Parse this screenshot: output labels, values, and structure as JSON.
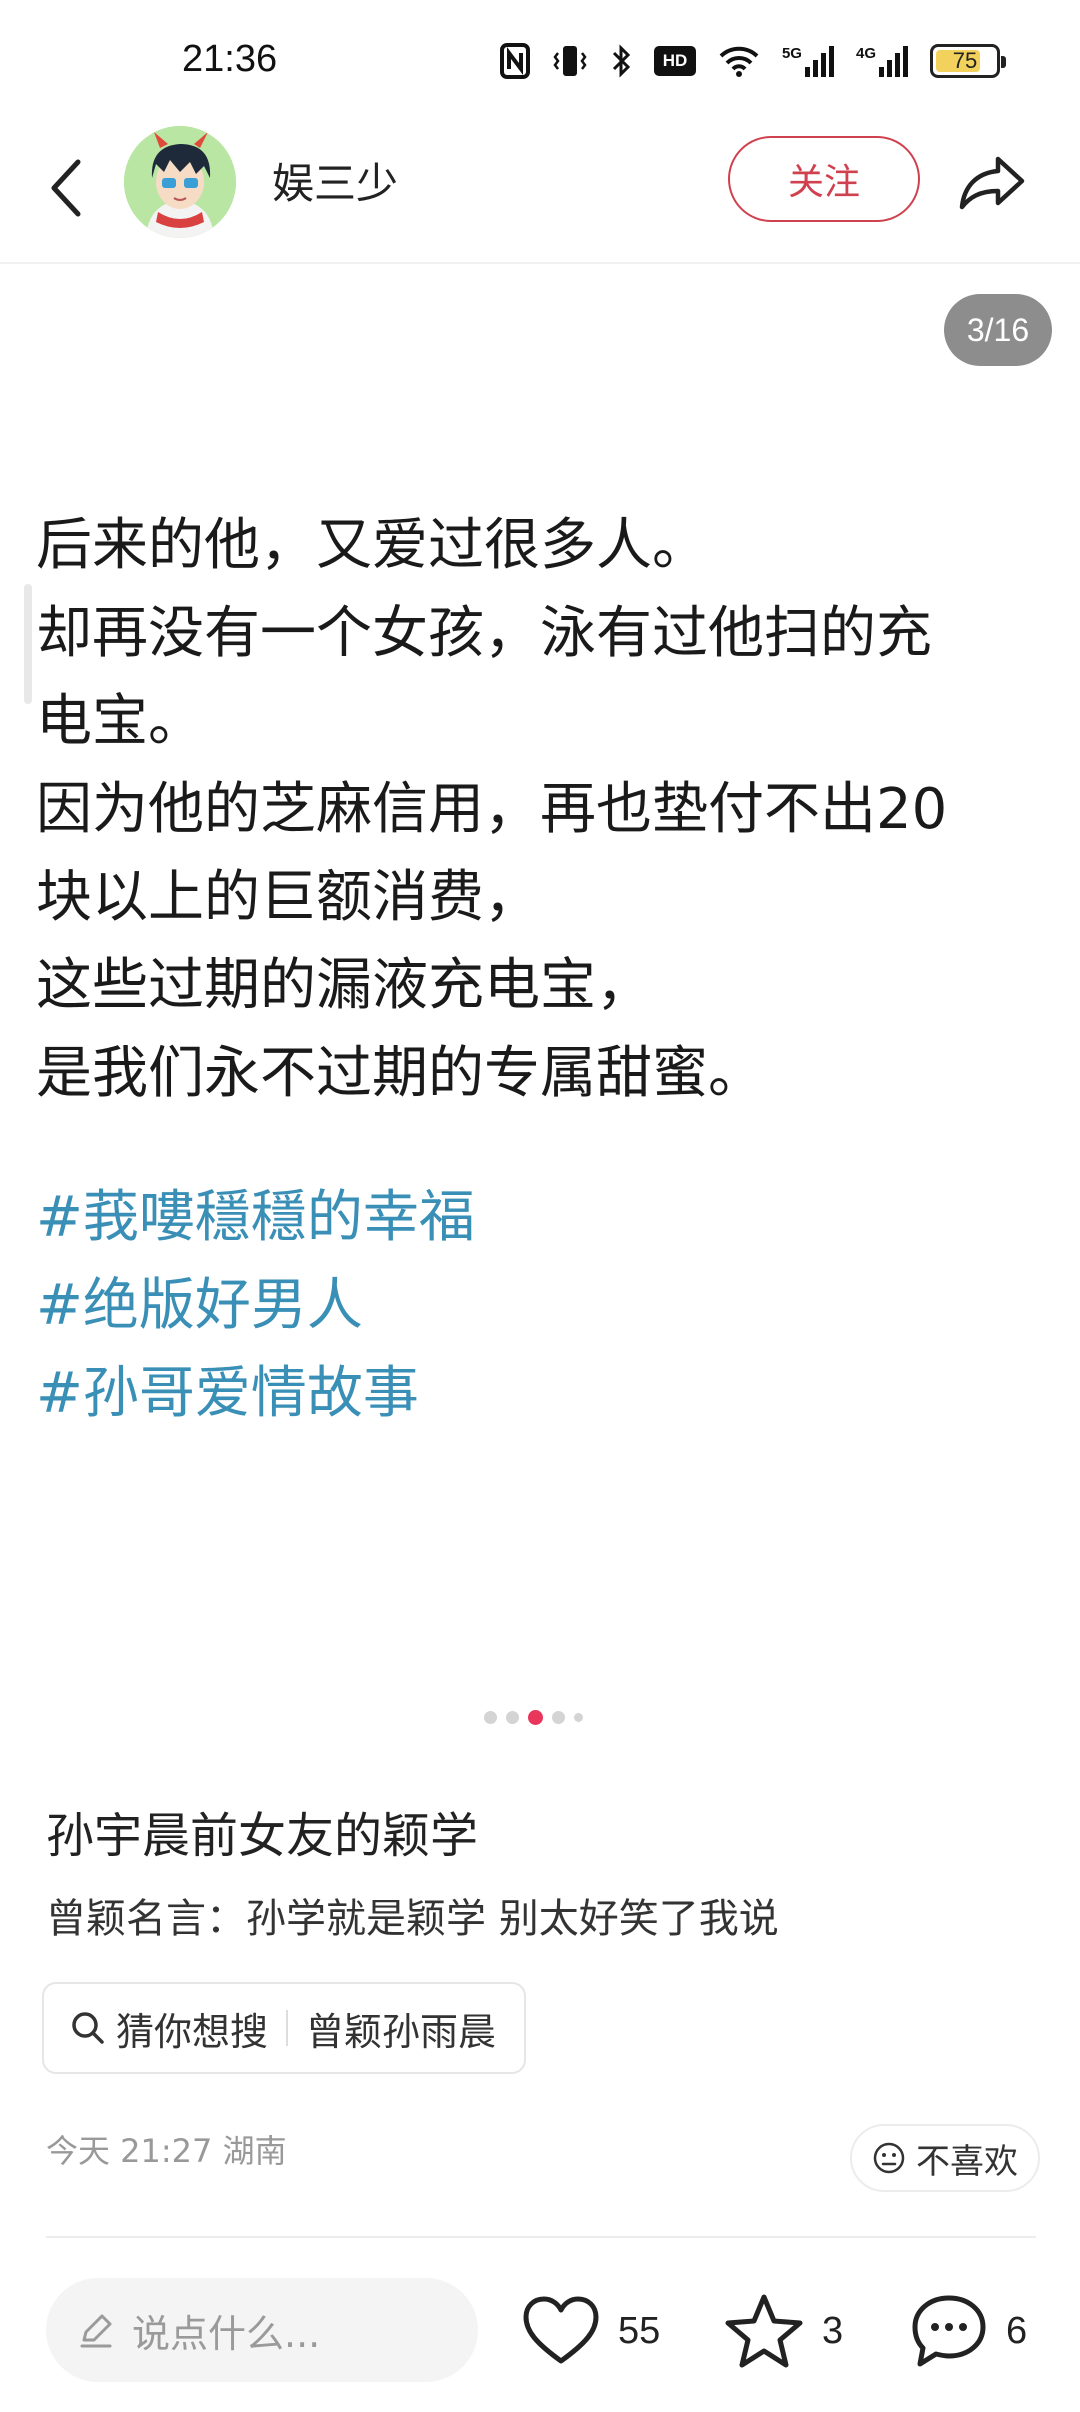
{
  "status_bar": {
    "time": "21:36",
    "icons": [
      "nfc-icon",
      "vibrate-icon",
      "bluetooth-icon",
      "hd-icon",
      "wifi-icon",
      "signal-5g-icon",
      "signal-4g-icon",
      "battery-icon"
    ],
    "hd_label": "HD",
    "network_5g": "5G",
    "network_4g": "4G",
    "battery_level": "75",
    "battery_fraction": 0.75
  },
  "header": {
    "username": "娱三少",
    "follow_label": "关注"
  },
  "content": {
    "page_counter": "3/16",
    "current_page_dot": 3,
    "body_lines": [
      "后来的他，又爱过很多人。",
      "却再没有一个女孩，泳有过他扫的充",
      "电宝。",
      "因为他的芝麻信用，再也垫付不出20",
      "块以上的巨额消费，",
      "这些过期的漏液充电宝，",
      "是我们永不过期的专属甜蜜。"
    ],
    "hashtags": [
      "#莪嘍穩穩的幸福",
      "#绝版好男人",
      "#孙哥爱情故事"
    ]
  },
  "post": {
    "title": "孙宇晨前女友的颖学",
    "description": "曾颖名言：孙学就是颖学 别太好笑了我说",
    "search_chip_label": "猜你想搜",
    "search_chip_query": "曾颖孙雨晨",
    "meta": "今天 21:27 湖南",
    "dislike_label": "不喜欢"
  },
  "bottom_bar": {
    "comment_placeholder": "说点什么...",
    "like_count": "55",
    "collect_count": "3",
    "comment_count": "6"
  },
  "colors": {
    "accent_red": "#d0414f",
    "hashtag_blue": "#3a8fb6",
    "active_dot": "#e8375a"
  }
}
